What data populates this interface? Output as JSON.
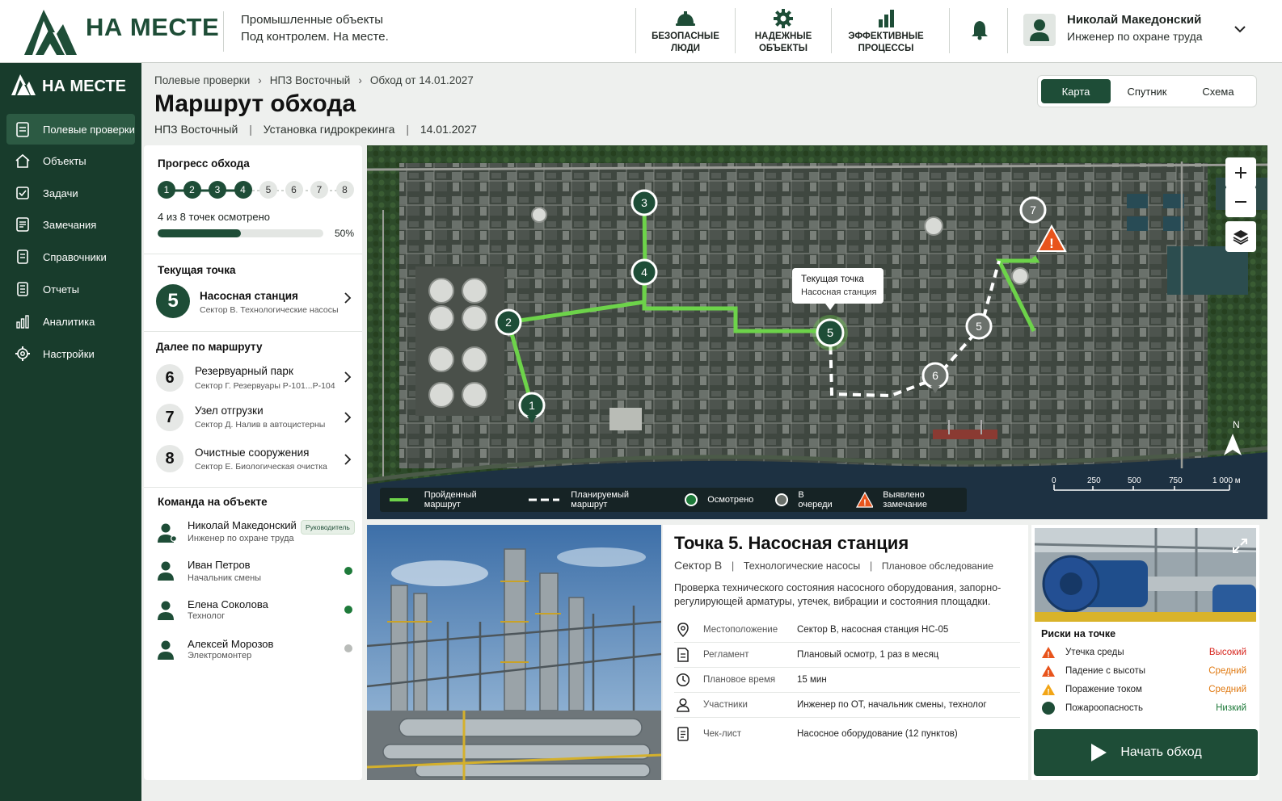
{
  "header": {
    "brand": "НА МЕСТЕ",
    "tagline_1": "Промышленные объекты",
    "tagline_2": "Под контролем. На месте.",
    "nav": [
      {
        "label": "БЕЗОПАСНЫЕ\nЛЮДИ",
        "icon": "helmet-icon"
      },
      {
        "label": "НАДЕЖНЫЕ\nОБЪЕКТЫ",
        "icon": "gear-icon"
      },
      {
        "label": "ЭФФЕКТИВНЫЕ\nПРОЦЕССЫ",
        "icon": "bar-chart-icon"
      }
    ],
    "user": {
      "name": "Николай Македонский",
      "role": "Инженер по охране труда"
    }
  },
  "sidebar": {
    "brand": "НА МЕСТЕ",
    "items": [
      {
        "label": "Полевые проверки",
        "icon": "clipboard-icon",
        "active": true
      },
      {
        "label": "Объекты",
        "icon": "home-icon"
      },
      {
        "label": "Задачи",
        "icon": "checkbox-icon"
      },
      {
        "label": "Замечания",
        "icon": "note-icon"
      },
      {
        "label": "Справочники",
        "icon": "book-icon"
      },
      {
        "label": "Отчеты",
        "icon": "report-icon"
      },
      {
        "label": "Аналитика",
        "icon": "analytics-icon"
      },
      {
        "label": "Настройки",
        "icon": "settings-icon"
      }
    ]
  },
  "page": {
    "breadcrumbs": [
      "Полевые проверки",
      "НПЗ Восточный",
      "Обход от 14.01.2027"
    ],
    "title": "Маршрут обхода",
    "sub": [
      "НПЗ Восточный",
      "Установка гидрокрекинга",
      "14.01.2027"
    ],
    "view_tabs": [
      "Карта",
      "Спутник",
      "Схема"
    ],
    "active_view": "Карта"
  },
  "progress": {
    "title": "Прогресс обхода",
    "steps": [
      "1",
      "2",
      "3",
      "4",
      "5",
      "6",
      "7",
      "8"
    ],
    "done_count": 4,
    "summary": "4 из 8 точек осмотрено",
    "percent_label": "50%",
    "fraction": 0.5
  },
  "current": {
    "title": "Текущая точка",
    "number": "5",
    "name": "Насосная станция",
    "sub": "Сектор В. Технологические насосы"
  },
  "next": {
    "title": "Далее по маршруту",
    "items": [
      {
        "number": "6",
        "name": "Резервуарный парк",
        "sub": "Сектор Г. Резервуары Р-101...Р-104"
      },
      {
        "number": "7",
        "name": "Узел отгрузки",
        "sub": "Сектор Д. Налив в автоцистерны"
      },
      {
        "number": "8",
        "name": "Очистные сооружения",
        "sub": "Сектор Е. Биологическая очистка"
      }
    ]
  },
  "team": {
    "title": "Команда на объекте",
    "members": [
      {
        "name": "Николай Македонский",
        "role": "Инженер по охране труда",
        "badge": "Руководитель",
        "status": ""
      },
      {
        "name": "Иван Петров",
        "role": "Начальник смены",
        "status": "online",
        "status_color": "#1e7a3a"
      },
      {
        "name": "Елена Соколова",
        "role": "Технолог",
        "status": "online",
        "status_color": "#1e7a3a"
      },
      {
        "name": "Алексей Морозов",
        "role": "Электромонтер",
        "status": "offline",
        "status_color": "#b9bcb9"
      }
    ]
  },
  "map": {
    "tooltip_title": "Текущая точка",
    "tooltip_sub": "Насосная станция",
    "markers": [
      "1",
      "2",
      "3",
      "4",
      "5",
      "5",
      "6",
      "7"
    ],
    "north": "N",
    "scale": [
      "0",
      "250",
      "500",
      "750",
      "1 000 м"
    ],
    "legend": [
      "Пройденный маршрут",
      "Планируемый маршрут",
      "Осмотрено",
      "В очереди",
      "Выявлено замечание"
    ],
    "colors": {
      "done": "#6dd34a",
      "marker": "#1e4d37",
      "issue": "#e8541c"
    }
  },
  "point": {
    "title": "Точка 5. Насосная станция",
    "meta": [
      "Сектор В",
      "Технологические насосы",
      "Плановое обследование"
    ],
    "desc": "Проверка технического состояния насосного оборудования, запорно-регулирующей арматуры, утечек, вибрации и состояния площадки.",
    "rows": [
      {
        "key": "Местоположение",
        "value": "Сектор В, насосная станция НС-05",
        "icon": "location-icon"
      },
      {
        "key": "Регламент",
        "value": "Плановый осмотр, 1 раз в месяц",
        "icon": "document-icon"
      },
      {
        "key": "Плановое время",
        "value": "15 мин",
        "icon": "clock-icon"
      },
      {
        "key": "Участники",
        "value": "Инженер по ОТ, начальник смены, технолог",
        "icon": "person-icon"
      },
      {
        "key": "Чек-лист",
        "value": "Насосное оборудование (12 пунктов)",
        "icon": "checklist-icon"
      }
    ]
  },
  "risks": {
    "title": "Риски на точке",
    "items": [
      {
        "name": "Утечка среды",
        "level": "Высокий",
        "color": "#d7261e",
        "icon": "warning-icon"
      },
      {
        "name": "Падение с высоты",
        "level": "Средний",
        "color": "#e07a12",
        "icon": "warning-icon"
      },
      {
        "name": "Поражение током",
        "level": "Средний",
        "color": "#e07a12",
        "icon": "warning-icon"
      },
      {
        "name": "Пожароопасность",
        "level": "Низкий",
        "color": "#1e7a3a",
        "icon": "circle-icon"
      }
    ]
  },
  "start_button": "Начать обход"
}
